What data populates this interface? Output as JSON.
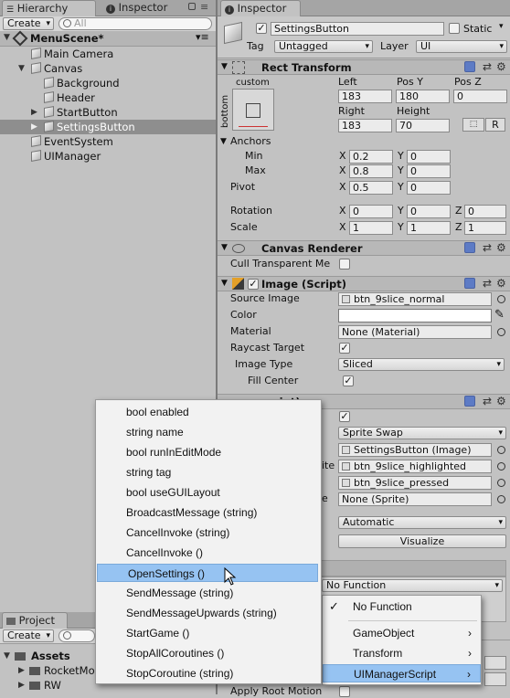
{
  "hierarchy": {
    "tab": "Hierarchy",
    "inspector_tab": "Inspector",
    "create": "Create",
    "search_placeholder": "All",
    "scene": "MenuScene*",
    "items": [
      {
        "label": "Main Camera"
      },
      {
        "label": "Canvas"
      },
      {
        "label": "Background"
      },
      {
        "label": "Header"
      },
      {
        "label": "StartButton"
      },
      {
        "label": "SettingsButton"
      },
      {
        "label": "EventSystem"
      },
      {
        "label": "UIManager"
      }
    ]
  },
  "project": {
    "tab": "Project",
    "create": "Create",
    "assets": "Assets",
    "items": [
      {
        "label": "RocketMo"
      },
      {
        "label": "RW"
      }
    ]
  },
  "inspector": {
    "tab": "Inspector",
    "name": "SettingsButton",
    "static": "Static",
    "tag_label": "Tag",
    "tag_value": "Untagged",
    "layer_label": "Layer",
    "layer_value": "UI",
    "rect": {
      "title": "Rect Transform",
      "anchor_preset": "custom",
      "side": "bottom",
      "left_label": "Left",
      "posy_label": "Pos Y",
      "posz_label": "Pos Z",
      "left": "183",
      "posy": "180",
      "posz": "0",
      "right_label": "Right",
      "height_label": "Height",
      "right": "183",
      "height": "70",
      "raw": "R",
      "anchors": "Anchors",
      "min": "Min",
      "max": "Max",
      "pivot": "Pivot",
      "min_x": "0.2",
      "min_y": "0",
      "max_x": "0.8",
      "max_y": "0",
      "pivot_x": "0.5",
      "pivot_y": "0",
      "rotation": "Rotation",
      "scale": "Scale",
      "rot_x": "0",
      "rot_y": "0",
      "rot_z": "0",
      "scale_x": "1",
      "scale_y": "1",
      "scale_z": "1",
      "x": "X",
      "y": "Y",
      "z": "Z"
    },
    "canvas_renderer": {
      "title": "Canvas Renderer",
      "cull": "Cull Transparent Me"
    },
    "image": {
      "title": "Image (Script)",
      "source_label": "Source Image",
      "source": "btn_9slice_normal",
      "color_label": "Color",
      "material_label": "Material",
      "material": "None (Material)",
      "raycast_label": "Raycast Target",
      "type_label": "Image Type",
      "type_value": "Sliced",
      "fill_label": "Fill Center"
    },
    "button": {
      "title_fragment": "ript)",
      "transition": "Sprite Swap",
      "target": "SettingsButton (Image)",
      "highlighted_label": "ite",
      "highlighted": "btn_9slice_highlighted",
      "pressed": "btn_9slice_pressed",
      "disabled_label": "e",
      "disabled": "None (Sprite)",
      "navigation": "Automatic",
      "visualize": "Visualize",
      "function": "No Function"
    },
    "animator_fragment": "Apply Root Motion"
  },
  "menu1": {
    "items": [
      {
        "label": "bool enabled"
      },
      {
        "label": "string name"
      },
      {
        "label": "bool runInEditMode"
      },
      {
        "label": "string tag"
      },
      {
        "label": "bool useGUILayout"
      },
      {
        "label": "BroadcastMessage (string)"
      },
      {
        "label": "CancelInvoke (string)"
      },
      {
        "label": "CancelInvoke ()"
      },
      {
        "label": "OpenSettings ()"
      },
      {
        "label": "SendMessage (string)"
      },
      {
        "label": "SendMessageUpwards (string)"
      },
      {
        "label": "StartGame ()"
      },
      {
        "label": "StopAllCoroutines ()"
      },
      {
        "label": "StopCoroutine (string)"
      }
    ],
    "highlighted": "OpenSettings ()"
  },
  "menu2": {
    "items": [
      {
        "label": "No Function",
        "checked": true
      },
      {
        "label": "GameObject"
      },
      {
        "label": "Transform"
      },
      {
        "label": "UIManagerScript"
      }
    ],
    "highlighted": "UIManagerScript"
  },
  "colors": {
    "highlight": "#96c3f2",
    "selection": "#8e8e8e",
    "panel": "#c2c2c2"
  }
}
